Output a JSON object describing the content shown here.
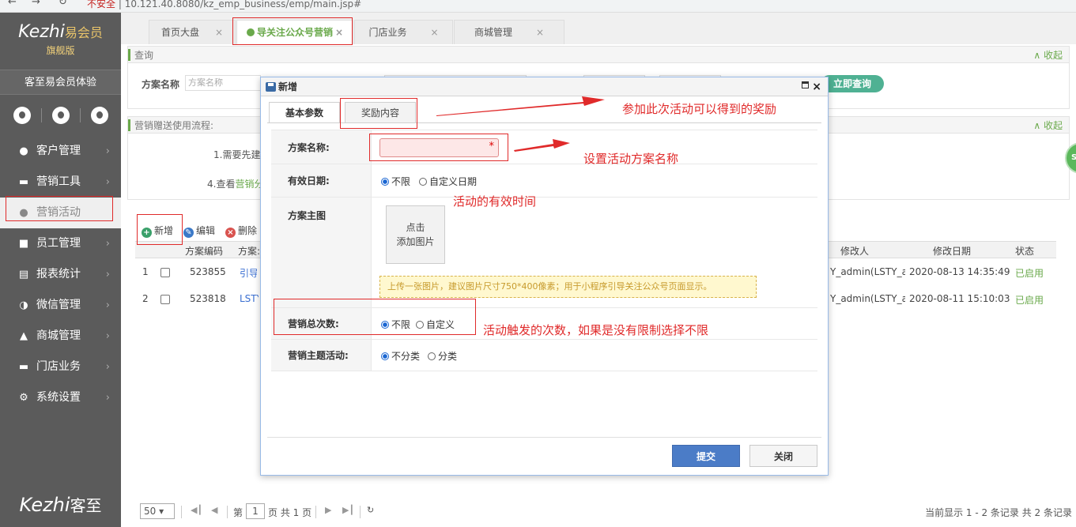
{
  "browser": {
    "security_warning": "不安全",
    "url": "10.121.40.8080/kz_emp_business/emp/main.jsp#"
  },
  "sidebar": {
    "logo_latin": "Kezhi",
    "logo_cn": "易会员",
    "edition": "旗舰版",
    "shop_name": "客至易会员体验",
    "items": [
      {
        "icon": "user-icon",
        "label": "客户管理"
      },
      {
        "icon": "briefcase-icon",
        "label": "营销工具"
      },
      {
        "icon": "bulb-icon",
        "label": "营销活动"
      },
      {
        "icon": "staff-icon",
        "label": "员工管理"
      },
      {
        "icon": "report-icon",
        "label": "报表统计"
      },
      {
        "icon": "wechat-icon",
        "label": "微信管理"
      },
      {
        "icon": "shop-icon",
        "label": "商城管理"
      },
      {
        "icon": "store-icon",
        "label": "门店业务"
      },
      {
        "icon": "gear-icon",
        "label": "系统设置"
      }
    ],
    "bottom_logo_latin": "Kezhi",
    "bottom_logo_cn": "客至"
  },
  "tabs": [
    {
      "label": "首页大盘"
    },
    {
      "label": "导关注公众号营销"
    },
    {
      "label": "门店业务"
    },
    {
      "label": "商城管理"
    }
  ],
  "query_panel": {
    "title": "查询",
    "collapse": "收起",
    "field_label": "方案名称",
    "field_placeholder": "方案名称",
    "query_button": "立即查询"
  },
  "flow_panel": {
    "title": "营销赠送使用流程:",
    "collapse": "收起",
    "step1_prefix": "1.需要先建",
    "step4_prefix": "4.查看",
    "step4_link": "营销分"
  },
  "toolbar": {
    "add": "新增",
    "edit": "编辑",
    "delete": "删除"
  },
  "grid": {
    "columns": {
      "code": "方案编码",
      "name": "方案:",
      "modifier": "修改人",
      "modified_date": "修改日期",
      "status": "状态"
    },
    "rows": [
      {
        "index": "1",
        "code": "523855",
        "name": "引导",
        "modifier": "Y_admin(LSTY_a",
        "date": "2020-08-13 14:35:49",
        "status": "已启用"
      },
      {
        "index": "2",
        "code": "523818",
        "name": "LSTY",
        "modifier": "Y_admin(LSTY_a",
        "date": "2020-08-11 15:10:03",
        "status": "已启用"
      }
    ]
  },
  "pager": {
    "page_size": "50",
    "page_prefix": "第",
    "page_number": "1",
    "page_suffix": "页 共 1 页",
    "summary": "当前显示 1 - 2 条记录 共 2 条记录"
  },
  "dialog": {
    "title": "新增",
    "tab_basic": "基本参数",
    "tab_reward": "奖励内容",
    "name_label": "方案名称:",
    "required_mark": "*",
    "validity_label": "有效日期:",
    "validity_opt1": "不限",
    "validity_opt2": "自定义日期",
    "image_label": "方案主图",
    "upload_line1": "点击",
    "upload_line2": "添加图片",
    "upload_tip": "上传一张图片，建议图片尺寸750*400像素；用于小程序引导关注公众号页面显示。",
    "count_label": "营销总次数:",
    "count_opt1": "不限",
    "count_opt2": "自定义",
    "theme_label": "营销主题活动:",
    "theme_opt1": "不分类",
    "theme_opt2": "分类",
    "submit": "提交",
    "close": "关闭"
  },
  "annotations": {
    "reward": "参加此次活动可以得到的奖励",
    "name": "设置活动方案名称",
    "validity": "活动的有效时间",
    "count": "活动触发的次数，如果是没有限制选择不限"
  },
  "side_bubble": "Sa",
  "colors": {
    "accent_green": "#6aa94b",
    "sidebar_bg": "#5b5b5b",
    "annotation_red": "#e02a2a",
    "submit_blue": "#4b7cc7"
  }
}
